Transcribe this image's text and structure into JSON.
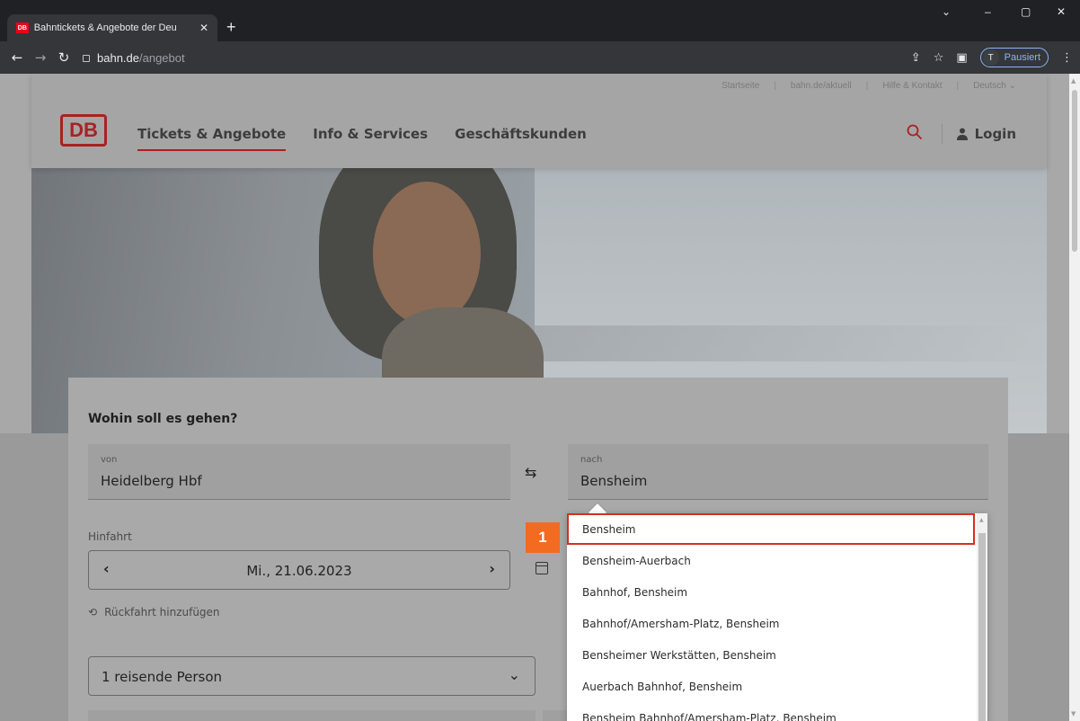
{
  "browser": {
    "tab_title": "Bahntickets & Angebote der Deu",
    "tab_favicon": "DB",
    "url_host": "bahn.de",
    "url_path": "/angebot",
    "profile_initial": "T",
    "profile_status": "Pausiert"
  },
  "utility_nav": [
    "Startseite",
    "bahn.de/aktuell",
    "Hilfe & Kontakt",
    "Deutsch"
  ],
  "header": {
    "logo": "DB",
    "nav": [
      "Tickets & Angebote",
      "Info & Services",
      "Geschäftskunden"
    ],
    "login": "Login"
  },
  "search": {
    "title": "Wohin soll es gehen?",
    "from_label": "von",
    "from_value": "Heidelberg Hbf",
    "to_label": "nach",
    "to_value": "Bensheim",
    "outbound_label": "Hinfahrt",
    "date": "Mi., 21.06.2023",
    "return_link": "Rückfahrt hinzufügen",
    "travellers": "1 reisende Person"
  },
  "suggestions": [
    "Bensheim",
    "Bensheim-Auerbach",
    "Bahnhof, Bensheim",
    "Bahnhof/Amersham-Platz, Bensheim",
    "Bensheimer Werkstätten, Bensheim",
    "Auerbach Bahnhof, Bensheim",
    "Bensheim Bahnhof/Amersham-Platz, Bensheim"
  ],
  "step_marker": "1",
  "colors": {
    "db_red": "#ec0016",
    "highlight": "#d5301f",
    "step_orange": "#f26b21"
  }
}
